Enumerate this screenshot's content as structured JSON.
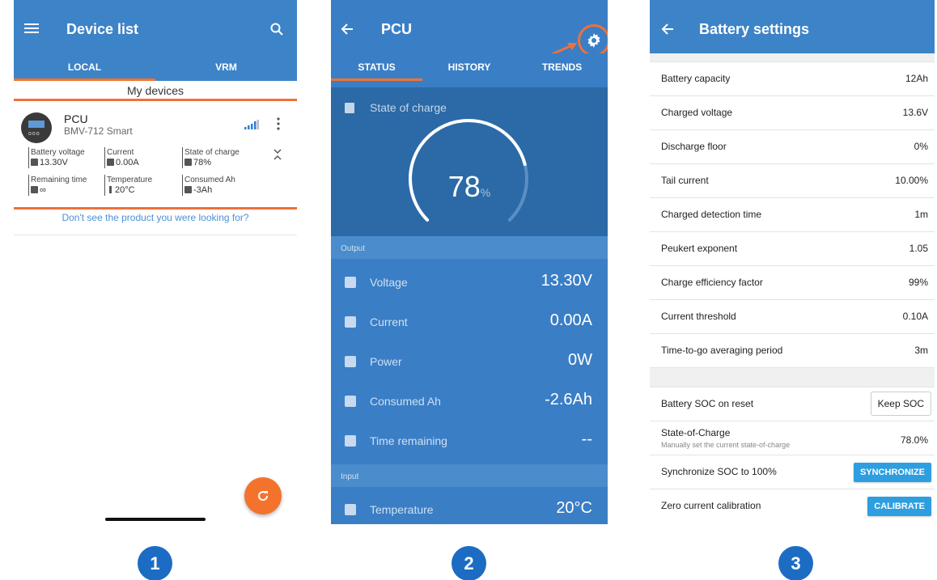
{
  "screen1": {
    "title": "Device list",
    "tabs": [
      "LOCAL",
      "VRM"
    ],
    "section_title": "My devices",
    "device": {
      "name": "PCU",
      "model": "BMV-712 Smart",
      "fields": [
        {
          "label": "Battery voltage",
          "value": "13.30V",
          "icon": "battery-icon"
        },
        {
          "label": "Current",
          "value": "0.00A",
          "icon": "current-icon"
        },
        {
          "label": "State of charge",
          "value": "78%",
          "icon": "soc-icon"
        },
        {
          "label": "Remaining time",
          "value": "∞",
          "icon": "clock-icon"
        },
        {
          "label": "Temperature",
          "value": "20°C",
          "icon": "thermometer-icon"
        },
        {
          "label": "Consumed Ah",
          "value": "-3Ah",
          "icon": "consumed-icon"
        }
      ]
    },
    "footer_link": "Don't see the product you were looking for?"
  },
  "screen2": {
    "title": "PCU",
    "tabs": [
      "STATUS",
      "HISTORY",
      "TRENDS"
    ],
    "soc_label": "State of charge",
    "soc_value": "78",
    "soc_unit": "%",
    "soc_fraction": 0.78,
    "output_label": "Output",
    "input_label": "Input",
    "rows": [
      {
        "label": "Voltage",
        "value": "13.30V"
      },
      {
        "label": "Current",
        "value": "0.00A"
      },
      {
        "label": "Power",
        "value": "0W"
      },
      {
        "label": "Consumed Ah",
        "value": "-2.6Ah"
      },
      {
        "label": "Time remaining",
        "value": "--"
      }
    ],
    "input_rows": [
      {
        "label": "Temperature",
        "value": "20°C"
      }
    ]
  },
  "screen3": {
    "title": "Battery settings",
    "rows": [
      {
        "label": "Battery capacity",
        "value": "12Ah"
      },
      {
        "label": "Charged voltage",
        "value": "13.6V"
      },
      {
        "label": "Discharge floor",
        "value": "0%"
      },
      {
        "label": "Tail current",
        "value": "10.00%"
      },
      {
        "label": "Charged detection time",
        "value": "1m"
      },
      {
        "label": "Peukert exponent",
        "value": "1.05"
      },
      {
        "label": "Charge efficiency factor",
        "value": "99%"
      },
      {
        "label": "Current threshold",
        "value": "0.10A"
      },
      {
        "label": "Time-to-go averaging period",
        "value": "3m"
      }
    ],
    "soc_reset_label": "Battery SOC on reset",
    "soc_reset_value": "Keep SOC",
    "soc_label": "State-of-Charge",
    "soc_sub": "Manually set the current state-of-charge",
    "soc_value": "78.0%",
    "sync_label": "Synchronize SOC to 100%",
    "sync_button": "SYNCHRONIZE",
    "zero_label": "Zero current calibration",
    "zero_button": "CALIBRATE"
  },
  "steps": [
    "1",
    "2",
    "3"
  ],
  "colors": {
    "primary": "#3d83c8",
    "accent": "#f4732c",
    "highlight": "#f0703a",
    "button": "#2d9ee0",
    "step": "#1d6cc4"
  }
}
